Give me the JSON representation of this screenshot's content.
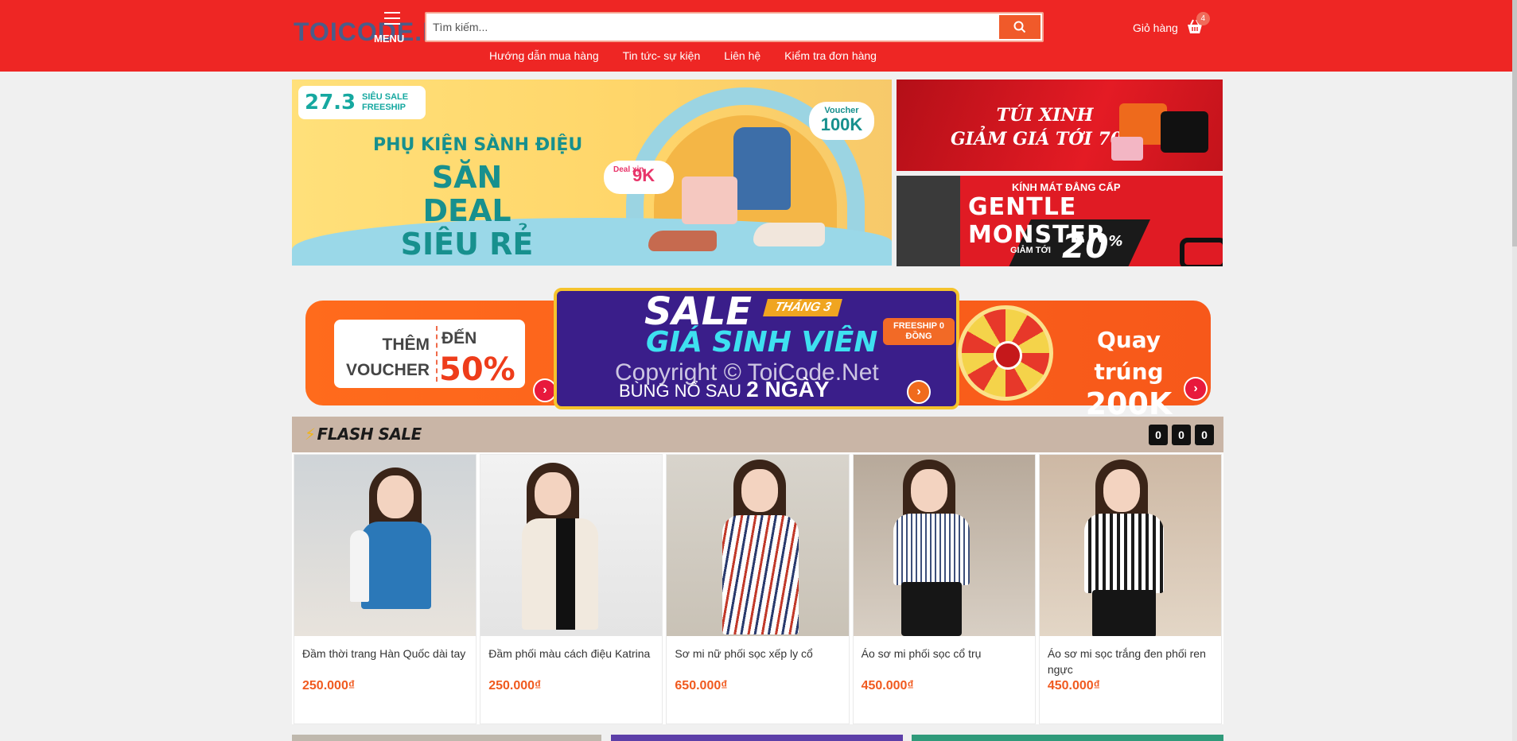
{
  "header": {
    "logo_text": "TOICODE.NET",
    "menu_label": "MENU",
    "search_placeholder": "Tìm kiếm...",
    "cart_label": "Giỏ hàng",
    "cart_count": "4",
    "nav": [
      "Hướng dẫn mua hàng",
      "Tin tức- sự kiện",
      "Liên hệ",
      "Kiểm tra đơn hàng"
    ]
  },
  "banners": {
    "main": {
      "date": "27.3",
      "tag_line1": "SIÊU SALE",
      "tag_line2": "FREESHIP",
      "line1": "PHỤ KIỆN SÀNH ĐIỆU",
      "line2": "SĂN DEAL SIÊU RẺ",
      "voucher_label": "Voucher",
      "voucher_value": "100K",
      "deal_label": "Deal xịn",
      "deal_value": "9K"
    },
    "right_top": {
      "line1": "TÚI XINH",
      "line2": "GIẢM GIÁ TỚI 70%"
    },
    "right_bottom": {
      "small": "KÍNH MÁT ĐẲNG CẤP",
      "brand": "GENTLE MONSTER",
      "discount_label": "GIẢM TỚI",
      "discount_value": "20",
      "percent": "%"
    }
  },
  "promo": {
    "left_line1": "THÊM",
    "left_line2": "VOUCHER",
    "left_up_to": "ĐẾN",
    "left_value": "50%",
    "center_sale": "SALE",
    "center_month": "THÁNG 3",
    "center_line": "GIÁ SINH VIÊN",
    "center_freeship": "FREESHIP 0 ĐỒNG",
    "center_bottom": "BÙNG NỔ SAU",
    "center_bottom_bold": "2 NGÀY",
    "right_line1": "Quay trúng",
    "right_line2": "200K",
    "watermark": "Copyright © ToiCode.Net"
  },
  "flash_sale": {
    "title": "FLASH SALE",
    "countdown": [
      "0",
      "0",
      "0"
    ]
  },
  "products": [
    {
      "name": "Đầm thời trang Hàn Quốc dài tay",
      "price": "250.000₫"
    },
    {
      "name": "Đầm phối màu cách điệu Katrina",
      "price": "250.000₫"
    },
    {
      "name": "Sơ mi nữ phối sọc xếp ly cổ",
      "price": "650.000₫"
    },
    {
      "name": "Áo sơ mi phối sọc cổ trụ",
      "price": "450.000₫"
    },
    {
      "name": "Áo sơ mi sọc trắng đen phối ren ngực",
      "price": "450.000₫"
    }
  ],
  "colors": {
    "header_bg": "#ee2624",
    "price": "#f05a1f",
    "flash_bg": "#c9b5a6"
  }
}
